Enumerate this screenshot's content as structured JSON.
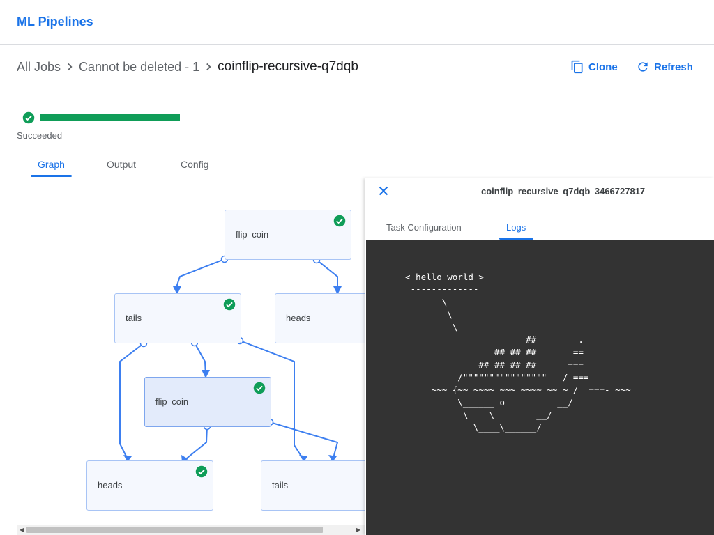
{
  "app": {
    "title": "ML Pipelines"
  },
  "breadcrumb": {
    "all_jobs": "All Jobs",
    "experiment": "Cannot be deleted - 1",
    "run": "coinflip-recursive-q7dqb"
  },
  "actions": {
    "clone": "Clone",
    "refresh": "Refresh"
  },
  "run_status": {
    "label": "Succeeded",
    "color": "#0f9d58",
    "icon": "check-circle-icon"
  },
  "tabs": {
    "graph": "Graph",
    "output": "Output",
    "config": "Config",
    "active": "Graph"
  },
  "graph": {
    "nodes": [
      {
        "label": "flip  coin",
        "status": "succeeded"
      },
      {
        "label": "tails",
        "status": "succeeded"
      },
      {
        "label": "heads",
        "status": ""
      },
      {
        "label": "flip  coin",
        "status": "succeeded",
        "selected": true
      },
      {
        "label": "heads",
        "status": "succeeded"
      },
      {
        "label": "tails",
        "status": ""
      }
    ]
  },
  "side_panel": {
    "title": "coinflip  recursive  q7dqb  3466727817",
    "tabs": {
      "task_config": "Task Configuration",
      "logs": "Logs",
      "active": "Logs"
    },
    "logs": [
      "   _____________",
      "  < hello world >",
      "   -------------",
      "         \\",
      "          \\",
      "           \\",
      "                         ##        .",
      "                   ## ## ##       ==",
      "                ## ## ## ##      ===",
      "            /\"\"\"\"\"\"\"\"\"\"\"\"\"\"\"\"___/ ===",
      "       ~~~ {~~ ~~~~ ~~~ ~~~~ ~~ ~ /  ===- ~~~",
      "            \\______ o          __/",
      "             \\    \\        __/",
      "               \\____\\______/"
    ]
  },
  "colors": {
    "accent": "#1a73e8",
    "success": "#0f9d58",
    "log_bg": "#333333"
  }
}
